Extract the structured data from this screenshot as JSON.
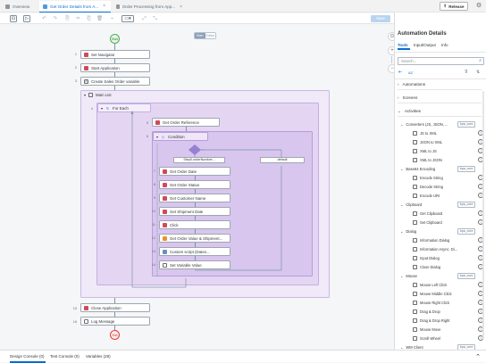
{
  "tabs": [
    {
      "label": "Overview"
    },
    {
      "label": "Get Order Details from A..."
    },
    {
      "label": "Order Processing from App..."
    }
  ],
  "header": {
    "release_label": "Release"
  },
  "toolbar": {
    "save_label": "Save"
  },
  "canvas": {
    "view_toggle": [
      "Start",
      "Editor"
    ],
    "start_label": "Start",
    "end_label": "End",
    "top_steps": [
      {
        "num": "1",
        "label": "Set Navigator"
      },
      {
        "num": "2",
        "label": "Start Application"
      },
      {
        "num": "3",
        "label": "Create Sales Order variable"
      }
    ],
    "main_list_label": "Main List",
    "for_each": {
      "num": "4",
      "label": "For Each"
    },
    "get_order_ref": {
      "num": "5",
      "label": "Get Order Reference"
    },
    "condition": {
      "num": "6",
      "label": "Condition"
    },
    "branch_left": "Step0.orderNumber...",
    "branch_right": "default",
    "cond_steps": [
      {
        "num": "7",
        "label": "Get Order Date"
      },
      {
        "num": "8",
        "label": "Get Order Status"
      },
      {
        "num": "9",
        "label": "Get Customer Name"
      },
      {
        "num": "10",
        "label": "Get Shipment Date"
      },
      {
        "num": "11",
        "label": "Click"
      },
      {
        "num": "12",
        "label": "Get Order Value & Shipment..."
      },
      {
        "num": "13",
        "label": "Custom script (Dates..."
      },
      {
        "num": "14",
        "label": "Set Variable Value"
      }
    ],
    "bottom_steps": [
      {
        "num": "15",
        "label": "Close Application"
      },
      {
        "num": "16",
        "label": "Log Message"
      }
    ]
  },
  "panel": {
    "title": "Automation Details",
    "tabs": [
      "Tools",
      "Input/Output",
      "Info"
    ],
    "search_placeholder": "Search...",
    "sort_label": "AZ",
    "sections": [
      "Automations",
      "Screens",
      "Activities"
    ],
    "groups": [
      {
        "label": "Converters (JS, JSON, ...",
        "badge": "bpa_core",
        "items": [
          "JS to XML",
          "JSON to XML",
          "XML to JS",
          "XML to JSON"
        ]
      },
      {
        "label": "Base64 Encoding",
        "badge": "bpa_core",
        "items": [
          "Encode String",
          "Decode String",
          "Encode URI"
        ]
      },
      {
        "label": "Clipboard",
        "badge": "bpa_core",
        "items": [
          "Get Clipboard",
          "Set Clipboard"
        ]
      },
      {
        "label": "Dialog",
        "badge": "bpa_core",
        "items": [
          "Information Dialog",
          "Information Async. Di...",
          "Input Dialog",
          "Close Dialog"
        ]
      },
      {
        "label": "Mouse",
        "badge": "bpa_core",
        "items": [
          "Mouse Left Click",
          "Mouse Middle Click",
          "Mouse Right Click",
          "Drag & Drop",
          "Drag & Drop Right",
          "Mouse Move",
          "Scroll Wheel"
        ]
      },
      {
        "label": "WM Client",
        "badge": "bpa_core",
        "items": []
      }
    ]
  },
  "bottom": {
    "tabs": [
      "Design Console (0)",
      "Test Console (0)",
      "Variables (28)"
    ]
  },
  "colors": {
    "accent": "#0a6ed1",
    "loop_bg": "#ece4f6",
    "inner_bg": "#ddcfef",
    "cond_bg": "#d2c1ea",
    "diamond": "#9b7fd6",
    "start": "#4caf50",
    "end": "#e53935"
  }
}
